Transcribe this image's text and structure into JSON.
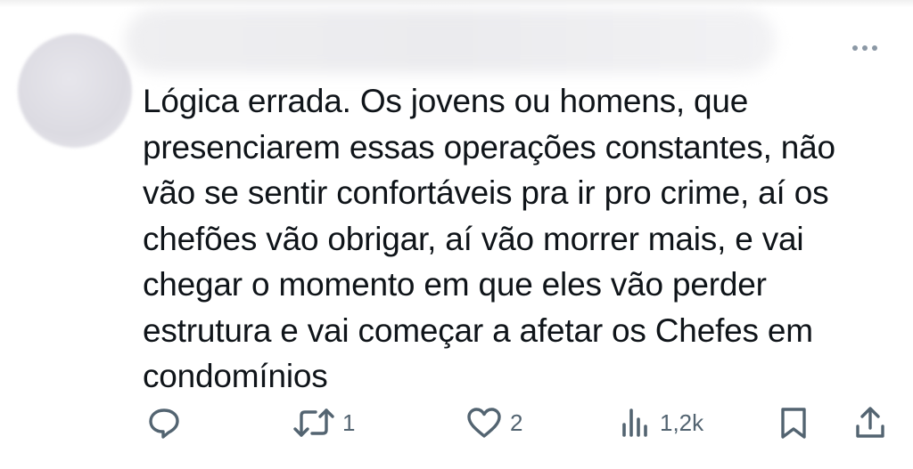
{
  "tweet": {
    "text": "Lógica errada. Os jovens ou homens, que\npresenciarem essas operações constantes, não\nvão se sentir confortáveis pra ir pro crime, aí os\nchefões vão obrigar, aí vão morrer mais, e vai\nchegar o momento em que eles vão perder\nestrutura e vai começar a afetar os Chefes em\ncondomínios"
  },
  "actions": {
    "reply": {
      "icon": "reply-icon"
    },
    "retweet": {
      "icon": "retweet-icon",
      "count": "1"
    },
    "like": {
      "icon": "heart-icon",
      "count": "2"
    },
    "views": {
      "icon": "views-icon",
      "count": "1,2k"
    },
    "bookmark": {
      "icon": "bookmark-icon"
    },
    "share": {
      "icon": "share-icon"
    }
  },
  "colors": {
    "text": "#0f1419",
    "icon": "#536471",
    "more": "#8b98a5"
  }
}
